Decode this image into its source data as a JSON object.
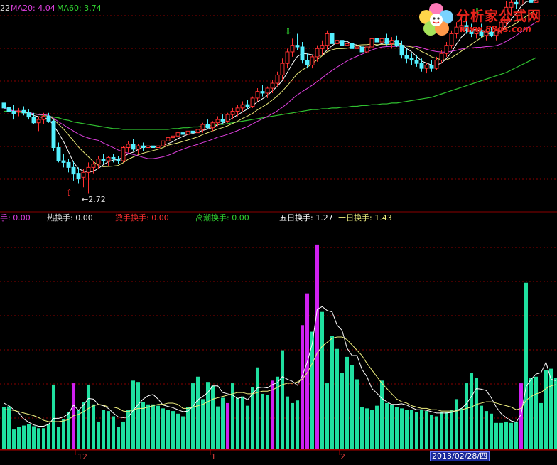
{
  "header": {
    "ma_prefix": "22",
    "ma20_label": "MA20: 4.04",
    "ma60_label": "MA60: 3.74",
    "ma_colors": {
      "ma5": "#ffffff",
      "ma10": "#e8e878",
      "ma20": "#e040e0",
      "ma60": "#30c030"
    }
  },
  "logo": {
    "title": "分析家公式网",
    "url": "www.88gs.com"
  },
  "price_annotation": "2.72",
  "turnover_header": {
    "t0": "手: 0.00",
    "t1": "热换手: 0.00",
    "t2": "烫手换手: 0.00",
    "t3": "高潮换手: 0.00",
    "t4": "五日换手: 1.27",
    "t5": "十日换手: 1.43"
  },
  "xaxis": {
    "labels": [
      "12",
      "1",
      "2"
    ],
    "cursor_date": "2013/02/28/四"
  },
  "colors": {
    "up": "#ff3030",
    "down": "#54f0ff",
    "vol_normal": "#1fe0a0",
    "vol_high": "#d020f0",
    "grid": "#8b0000"
  },
  "chart_data": [
    {
      "type": "candlestick",
      "title": "",
      "ylim": [
        2.5,
        5.0
      ],
      "ohlc": [
        [
          3.82,
          3.88,
          3.7,
          3.76
        ],
        [
          3.77,
          3.85,
          3.67,
          3.72
        ],
        [
          3.72,
          3.8,
          3.62,
          3.69
        ],
        [
          3.71,
          3.76,
          3.66,
          3.72
        ],
        [
          3.73,
          3.78,
          3.67,
          3.7
        ],
        [
          3.7,
          3.74,
          3.62,
          3.65
        ],
        [
          3.65,
          3.7,
          3.56,
          3.58
        ],
        [
          3.58,
          3.66,
          3.48,
          3.62
        ],
        [
          3.62,
          3.7,
          3.56,
          3.66
        ],
        [
          3.66,
          3.7,
          3.58,
          3.6
        ],
        [
          3.6,
          3.62,
          3.24,
          3.28
        ],
        [
          3.28,
          3.34,
          3.1,
          3.12
        ],
        [
          3.12,
          3.2,
          3.04,
          3.1
        ],
        [
          3.1,
          3.14,
          2.98,
          3.04
        ],
        [
          3.04,
          3.12,
          2.88,
          2.96
        ],
        [
          2.96,
          3.04,
          2.84,
          2.9
        ],
        [
          2.92,
          3.02,
          2.8,
          2.98
        ],
        [
          2.98,
          3.1,
          2.72,
          3.04
        ],
        [
          3.04,
          3.12,
          2.96,
          3.08
        ],
        [
          3.08,
          3.18,
          3.02,
          3.14
        ],
        [
          3.14,
          3.2,
          3.08,
          3.12
        ],
        [
          3.12,
          3.18,
          3.06,
          3.16
        ],
        [
          3.16,
          3.2,
          3.1,
          3.14
        ],
        [
          3.14,
          3.18,
          3.08,
          3.12
        ],
        [
          3.12,
          3.3,
          3.1,
          3.28
        ],
        [
          3.28,
          3.36,
          3.22,
          3.32
        ],
        [
          3.32,
          3.38,
          3.24,
          3.26
        ],
        [
          3.26,
          3.32,
          3.2,
          3.3
        ],
        [
          3.3,
          3.34,
          3.24,
          3.28
        ],
        [
          3.28,
          3.32,
          3.22,
          3.3
        ],
        [
          3.3,
          3.36,
          3.26,
          3.28
        ],
        [
          3.28,
          3.32,
          3.22,
          3.3
        ],
        [
          3.3,
          3.38,
          3.26,
          3.36
        ],
        [
          3.36,
          3.44,
          3.3,
          3.4
        ],
        [
          3.4,
          3.48,
          3.34,
          3.42
        ],
        [
          3.42,
          3.5,
          3.36,
          3.46
        ],
        [
          3.46,
          3.52,
          3.4,
          3.44
        ],
        [
          3.44,
          3.5,
          3.38,
          3.48
        ],
        [
          3.48,
          3.54,
          3.42,
          3.46
        ],
        [
          3.46,
          3.52,
          3.4,
          3.5
        ],
        [
          3.5,
          3.58,
          3.46,
          3.56
        ],
        [
          3.56,
          3.62,
          3.5,
          3.52
        ],
        [
          3.52,
          3.6,
          3.48,
          3.58
        ],
        [
          3.58,
          3.66,
          3.54,
          3.62
        ],
        [
          3.62,
          3.68,
          3.56,
          3.6
        ],
        [
          3.6,
          3.7,
          3.58,
          3.68
        ],
        [
          3.68,
          3.76,
          3.62,
          3.72
        ],
        [
          3.72,
          3.8,
          3.66,
          3.76
        ],
        [
          3.76,
          3.84,
          3.72,
          3.8
        ],
        [
          3.8,
          3.86,
          3.74,
          3.78
        ],
        [
          3.78,
          3.9,
          3.76,
          3.88
        ],
        [
          3.88,
          4.0,
          3.84,
          3.96
        ],
        [
          3.96,
          4.04,
          3.9,
          3.94
        ],
        [
          3.94,
          4.02,
          3.88,
          4.0
        ],
        [
          4.0,
          4.1,
          3.94,
          4.06
        ],
        [
          4.06,
          4.2,
          4.02,
          4.16
        ],
        [
          4.16,
          4.36,
          4.1,
          4.3
        ],
        [
          4.3,
          4.48,
          4.24,
          4.44
        ],
        [
          4.44,
          4.6,
          4.38,
          4.52
        ],
        [
          4.52,
          4.66,
          4.46,
          4.5
        ],
        [
          4.5,
          4.56,
          4.3,
          4.34
        ],
        [
          4.34,
          4.42,
          4.24,
          4.28
        ],
        [
          4.28,
          4.4,
          4.24,
          4.38
        ],
        [
          4.38,
          4.52,
          4.32,
          4.48
        ],
        [
          4.48,
          4.58,
          4.4,
          4.52
        ],
        [
          4.52,
          4.7,
          4.46,
          4.66
        ],
        [
          4.66,
          4.72,
          4.5,
          4.54
        ],
        [
          4.54,
          4.62,
          4.46,
          4.58
        ],
        [
          4.58,
          4.64,
          4.48,
          4.52
        ],
        [
          4.52,
          4.6,
          4.44,
          4.54
        ],
        [
          4.54,
          4.6,
          4.42,
          4.48
        ],
        [
          4.48,
          4.56,
          4.38,
          4.5
        ],
        [
          4.5,
          4.56,
          4.4,
          4.44
        ],
        [
          4.44,
          4.54,
          4.36,
          4.5
        ],
        [
          4.5,
          4.66,
          4.46,
          4.6
        ],
        [
          4.6,
          4.72,
          4.54,
          4.56
        ],
        [
          4.56,
          4.64,
          4.48,
          4.6
        ],
        [
          4.6,
          4.66,
          4.52,
          4.54
        ],
        [
          4.54,
          4.62,
          4.48,
          4.58
        ],
        [
          4.58,
          4.64,
          4.5,
          4.52
        ],
        [
          4.52,
          4.58,
          4.36,
          4.4
        ],
        [
          4.4,
          4.48,
          4.3,
          4.36
        ],
        [
          4.36,
          4.42,
          4.28,
          4.34
        ],
        [
          4.34,
          4.4,
          4.26,
          4.3
        ],
        [
          4.3,
          4.36,
          4.2,
          4.24
        ],
        [
          4.24,
          4.3,
          4.18,
          4.28
        ],
        [
          4.28,
          4.34,
          4.2,
          4.24
        ],
        [
          4.24,
          4.38,
          4.22,
          4.34
        ],
        [
          4.34,
          4.46,
          4.3,
          4.42
        ],
        [
          4.42,
          4.56,
          4.38,
          4.52
        ],
        [
          4.52,
          4.7,
          4.48,
          4.66
        ],
        [
          4.66,
          4.8,
          4.6,
          4.74
        ],
        [
          4.74,
          4.86,
          4.68,
          4.76
        ],
        [
          4.76,
          4.84,
          4.66,
          4.7
        ],
        [
          4.7,
          4.78,
          4.62,
          4.66
        ],
        [
          4.66,
          4.74,
          4.6,
          4.7
        ],
        [
          4.7,
          4.78,
          4.62,
          4.64
        ],
        [
          4.64,
          4.72,
          4.58,
          4.68
        ],
        [
          4.68,
          4.74,
          4.62,
          4.64
        ],
        [
          4.64,
          4.72,
          4.58,
          4.7
        ],
        [
          4.7,
          4.84,
          4.66,
          4.8
        ],
        [
          4.8,
          5.06,
          4.76,
          4.98
        ],
        [
          4.98,
          5.12,
          4.9,
          5.04
        ],
        [
          5.04,
          5.16,
          4.96,
          5.02
        ],
        [
          5.02,
          5.2,
          4.98,
          5.12
        ],
        [
          5.12,
          5.22,
          5.02,
          5.08
        ],
        [
          5.08,
          5.14,
          4.98,
          5.04
        ],
        [
          5.04,
          5.1,
          4.96,
          5.06
        ]
      ],
      "ma60": [
        3.72,
        3.72,
        3.71,
        3.71,
        3.7,
        3.7,
        3.69,
        3.68,
        3.67,
        3.66,
        3.65,
        3.64,
        3.62,
        3.61,
        3.59,
        3.58,
        3.57,
        3.56,
        3.55,
        3.54,
        3.53,
        3.52,
        3.51,
        3.51,
        3.5,
        3.5,
        3.5,
        3.5,
        3.5,
        3.5,
        3.5,
        3.5,
        3.5,
        3.5,
        3.51,
        3.51,
        3.52,
        3.52,
        3.53,
        3.53,
        3.54,
        3.54,
        3.55,
        3.56,
        3.56,
        3.57,
        3.58,
        3.59,
        3.6,
        3.61,
        3.62,
        3.63,
        3.64,
        3.65,
        3.66,
        3.67,
        3.68,
        3.69,
        3.7,
        3.71,
        3.72,
        3.73,
        3.74,
        3.74,
        3.75,
        3.75,
        3.76,
        3.76,
        3.77,
        3.77,
        3.78,
        3.78,
        3.79,
        3.79,
        3.8,
        3.8,
        3.81,
        3.81,
        3.82,
        3.82,
        3.83,
        3.84,
        3.85,
        3.86,
        3.87,
        3.88,
        3.89,
        3.91,
        3.93,
        3.95,
        3.97,
        3.99,
        4.01,
        4.03,
        4.05,
        4.07,
        4.09,
        4.11,
        4.13,
        4.15,
        4.17,
        4.19,
        4.22,
        4.25,
        4.28,
        4.31,
        4.34,
        4.37
      ],
      "annotations": [
        {
          "type": "low",
          "index": 17,
          "value": 2.72
        }
      ]
    },
    {
      "type": "bar",
      "title": "",
      "ylim": [
        0,
        3.4
      ],
      "values": [
        0.64,
        0.65,
        0.3,
        0.34,
        0.36,
        0.38,
        0.35,
        0.32,
        0.32,
        0.38,
        0.98,
        0.34,
        0.46,
        0.56,
        1.0,
        0.6,
        0.72,
        0.98,
        0.68,
        0.42,
        0.6,
        0.58,
        0.5,
        0.34,
        0.42,
        0.6,
        1.04,
        1.02,
        0.72,
        0.68,
        0.68,
        0.66,
        0.62,
        0.6,
        0.58,
        0.54,
        0.5,
        0.64,
        1.0,
        1.1,
        0.76,
        1.02,
        0.96,
        0.65,
        0.78,
        0.7,
        1.0,
        0.78,
        0.8,
        0.66,
        0.94,
        1.24,
        0.84,
        0.82,
        1.04,
        1.1,
        1.5,
        0.8,
        0.7,
        0.74,
        1.88,
        2.36,
        1.78,
        3.1,
        2.08,
        1.0,
        1.72,
        1.52,
        1.16,
        1.4,
        1.28,
        1.06,
        0.64,
        0.62,
        0.6,
        0.66,
        1.04,
        0.7,
        0.68,
        0.64,
        0.62,
        0.6,
        0.6,
        0.56,
        0.6,
        0.58,
        0.52,
        0.5,
        0.56,
        0.56,
        0.6,
        0.76,
        0.62,
        1.0,
        1.16,
        1.08,
        0.66,
        0.58,
        0.54,
        0.4,
        0.4,
        0.42,
        0.4,
        0.42,
        1.0,
        2.52,
        1.08,
        1.1,
        0.7,
        1.2,
        1.22,
        1.08
      ],
      "highlight": [
        14,
        45,
        54,
        60,
        61,
        63,
        104
      ],
      "ma5": [
        0.7,
        0.66,
        0.6,
        0.55,
        0.46,
        0.41,
        0.37,
        0.35,
        0.35,
        0.38,
        0.47,
        0.47,
        0.49,
        0.54,
        0.67,
        0.59,
        0.67,
        0.77,
        0.76,
        0.68,
        0.66,
        0.62,
        0.55,
        0.49,
        0.48,
        0.49,
        0.59,
        0.68,
        0.76,
        0.81,
        0.83,
        0.76,
        0.67,
        0.65,
        0.63,
        0.6,
        0.57,
        0.58,
        0.65,
        0.75,
        0.8,
        0.86,
        0.96,
        0.96,
        0.86,
        0.84,
        0.82,
        0.77,
        0.79,
        0.75,
        0.84,
        0.93,
        0.94,
        0.93,
        0.98,
        1.01,
        1.1,
        1.06,
        1.03,
        0.97,
        1.11,
        1.32,
        1.6,
        2.12,
        2.16,
        2.1,
        2.08,
        1.88,
        1.8,
        1.53,
        1.42,
        1.42,
        1.21,
        1.1,
        0.92,
        0.85,
        0.77,
        0.72,
        0.68,
        0.68,
        0.69,
        0.67,
        0.63,
        0.6,
        0.6,
        0.59,
        0.57,
        0.55,
        0.55,
        0.55,
        0.56,
        0.59,
        0.62,
        0.69,
        0.8,
        0.92,
        0.91,
        0.89,
        0.78,
        0.64,
        0.54,
        0.48,
        0.43,
        0.41,
        0.53,
        0.95,
        1.06,
        1.14,
        1.16,
        1.32,
        1.06,
        1.04
      ],
      "ma10": [
        0.6,
        0.6,
        0.59,
        0.57,
        0.55,
        0.53,
        0.51,
        0.48,
        0.44,
        0.42,
        0.42,
        0.42,
        0.43,
        0.45,
        0.51,
        0.53,
        0.57,
        0.62,
        0.66,
        0.68,
        0.67,
        0.64,
        0.64,
        0.62,
        0.58,
        0.57,
        0.6,
        0.62,
        0.62,
        0.64,
        0.66,
        0.68,
        0.68,
        0.7,
        0.7,
        0.68,
        0.62,
        0.62,
        0.64,
        0.66,
        0.68,
        0.72,
        0.76,
        0.78,
        0.8,
        0.82,
        0.84,
        0.86,
        0.86,
        0.84,
        0.84,
        0.86,
        0.88,
        0.88,
        0.9,
        0.94,
        0.98,
        1.0,
        1.0,
        1.02,
        1.06,
        1.16,
        1.3,
        1.46,
        1.56,
        1.62,
        1.68,
        1.7,
        1.7,
        1.66,
        1.58,
        1.5,
        1.42,
        1.3,
        1.2,
        1.1,
        1.0,
        0.92,
        0.84,
        0.76,
        0.72,
        0.7,
        0.66,
        0.64,
        0.62,
        0.62,
        0.6,
        0.6,
        0.58,
        0.58,
        0.58,
        0.58,
        0.6,
        0.62,
        0.64,
        0.68,
        0.7,
        0.72,
        0.72,
        0.7,
        0.68,
        0.66,
        0.64,
        0.6,
        0.62,
        0.74,
        0.8,
        0.84,
        0.86,
        0.92,
        0.96,
        0.98
      ]
    }
  ]
}
